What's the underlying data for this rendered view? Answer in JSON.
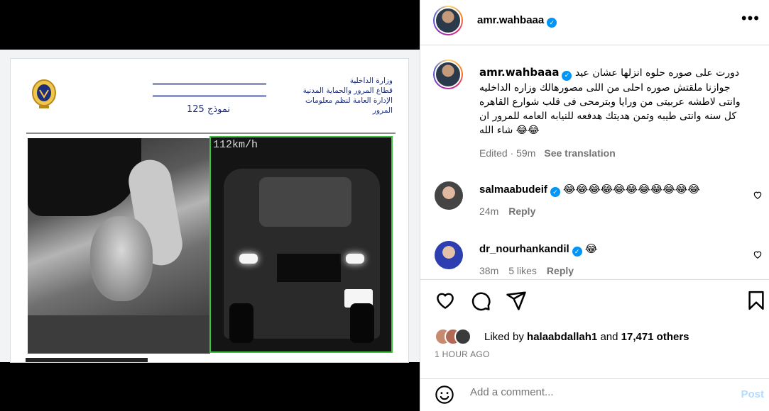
{
  "media": {
    "doc": {
      "ministry_lines": [
        "وزارة الداخلية",
        "قطاع المرور والحماية المدنية",
        "الإدارة العامة لنظم معلومات المرور"
      ],
      "form_number": "نموذج 125",
      "speed_readout": "112km/h"
    }
  },
  "post": {
    "author": "amr.wahbaaa",
    "verified": true,
    "caption": "دورت على صوره حلوه انزلها عشان عيد جوازنا ملقتش صوره احلى من اللى مصورهالك وزاره الداخليه وانتى لاطشه عربيتى من ورايا وبترمحى فى قلب شوارع القاهره كل سنه وانتى طيبه وتمن هديتك هدفعه للنيابه العامه للمرور ان شاء الله 😂😂",
    "edited_time": "Edited · 59m",
    "see_translation": "See translation",
    "likes_prefix": "Liked by",
    "liked_by_user": "halaabdallah1",
    "likes_and": "and",
    "likes_others": "17,471 others",
    "time_ago": "1 HOUR AGO"
  },
  "comments": [
    {
      "user": "salmaabudeif",
      "verified": true,
      "text": "😂😂😂😂😂😂😂😂😂😂😂",
      "time": "24m",
      "likes": "",
      "reply": "Reply"
    },
    {
      "user": "dr_nourhankandil",
      "verified": true,
      "text": "😂",
      "time": "38m",
      "likes": "5 likes",
      "reply": "Reply"
    }
  ],
  "add_comment": {
    "placeholder": "Add a comment...",
    "post_label": "Post"
  },
  "icons": [
    "more-icon",
    "heart-icon",
    "comment-icon",
    "share-icon",
    "save-icon",
    "smile-icon"
  ],
  "colors": {
    "accent": "#0095f6",
    "post_disabled": "#b3dbff",
    "muted": "#737373",
    "border": "#dbdbdb",
    "camera_border": "#3fc13f"
  }
}
